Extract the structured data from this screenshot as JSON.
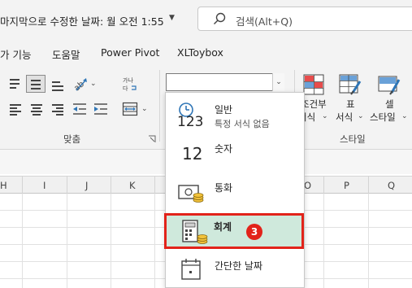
{
  "titlebar": {
    "title": "마지막으로 수정한 날짜: 월 오전 1:55",
    "search_text": "검색(Alt+Q)"
  },
  "menu": {
    "items": [
      "가 기능",
      "도움말",
      "Power Pivot",
      "XLToybox"
    ]
  },
  "ribbon": {
    "align_group_label": "맞춤",
    "style_group_label": "스타일",
    "conditional_label_1": "조건부",
    "conditional_label_2": "서식",
    "table_format_label_1": "표",
    "table_format_label_2": "서식",
    "cell_style_label_1": "셀",
    "cell_style_label_2": "스타일",
    "number_format_value": ""
  },
  "columns": [
    "H",
    "I",
    "J",
    "K",
    "O",
    "P",
    "Q"
  ],
  "format_menu": {
    "items": [
      {
        "title": "일반",
        "subtitle": "특정 서식 없음",
        "icon_text": "123",
        "icon": "clock-icon"
      },
      {
        "title": "숫자",
        "icon_text": "12",
        "icon": "number-icon"
      },
      {
        "title": "통화",
        "icon": "currency-icon"
      },
      {
        "title": "회계",
        "icon": "accounting-icon"
      },
      {
        "title": "간단한 날짜",
        "icon": "calendar-icon"
      }
    ],
    "step_badge": "3"
  },
  "colors": {
    "highlight_border": "#e2231a",
    "highlight_fill": "#cfe9dc"
  }
}
